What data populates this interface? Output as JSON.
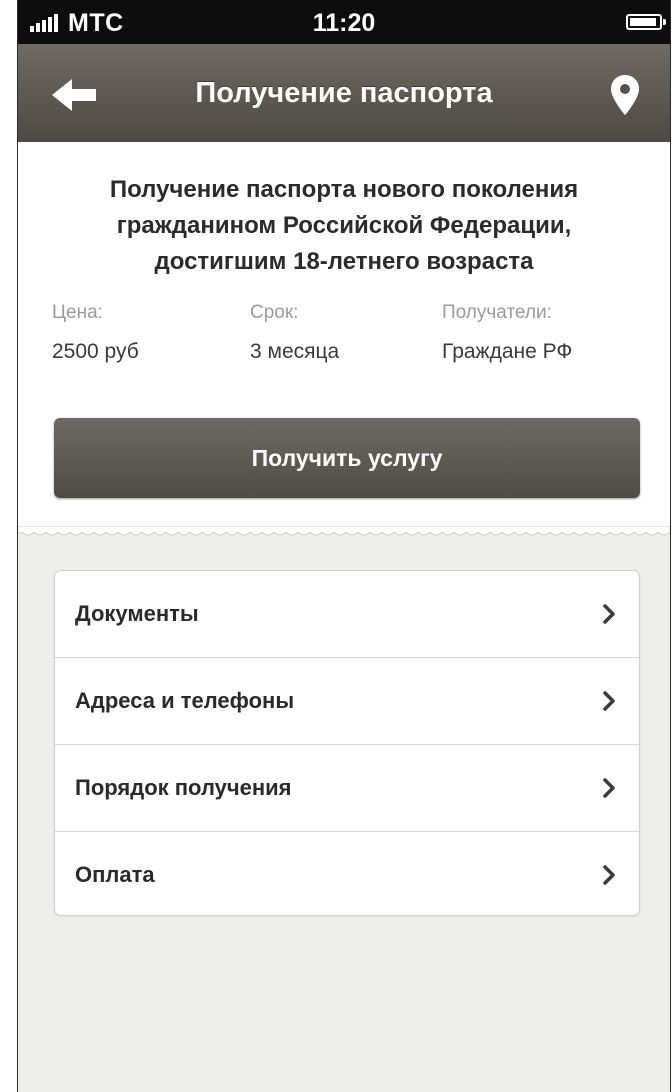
{
  "status_bar": {
    "carrier": "МТС",
    "time": "11:20"
  },
  "nav": {
    "title": "Получение паспорта",
    "back_icon": "back-arrow-icon",
    "location_icon": "location-pin-icon"
  },
  "service": {
    "headline": "Получение паспорта нового поколения гражданином Российской Федерации, достигшим 18-летнего возраста",
    "price_label": "Цена:",
    "price_value": "2500 руб",
    "term_label": "Срок:",
    "term_value": "3 месяца",
    "recipients_label": "Получатели:",
    "recipients_value": "Граждане РФ",
    "action_label": "Получить услугу"
  },
  "menu": {
    "items": [
      {
        "label": "Документы"
      },
      {
        "label": "Адреса и телефоны"
      },
      {
        "label": "Порядок получения"
      },
      {
        "label": "Оплата"
      }
    ],
    "chevron_icon": "chevron-right-icon"
  },
  "colors": {
    "navbar": "#5d5952",
    "button": "#5e5a54",
    "background": "#eeeeec"
  }
}
